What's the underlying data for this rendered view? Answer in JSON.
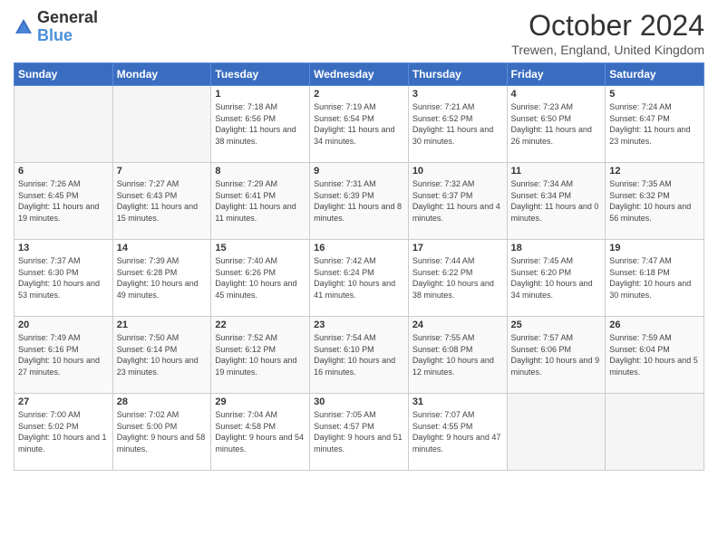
{
  "logo": {
    "general": "General",
    "blue": "Blue"
  },
  "title": "October 2024",
  "location": "Trewen, England, United Kingdom",
  "weekdays": [
    "Sunday",
    "Monday",
    "Tuesday",
    "Wednesday",
    "Thursday",
    "Friday",
    "Saturday"
  ],
  "weeks": [
    [
      {
        "day": "",
        "sunrise": "",
        "sunset": "",
        "daylight": ""
      },
      {
        "day": "",
        "sunrise": "",
        "sunset": "",
        "daylight": ""
      },
      {
        "day": "1",
        "sunrise": "Sunrise: 7:18 AM",
        "sunset": "Sunset: 6:56 PM",
        "daylight": "Daylight: 11 hours and 38 minutes."
      },
      {
        "day": "2",
        "sunrise": "Sunrise: 7:19 AM",
        "sunset": "Sunset: 6:54 PM",
        "daylight": "Daylight: 11 hours and 34 minutes."
      },
      {
        "day": "3",
        "sunrise": "Sunrise: 7:21 AM",
        "sunset": "Sunset: 6:52 PM",
        "daylight": "Daylight: 11 hours and 30 minutes."
      },
      {
        "day": "4",
        "sunrise": "Sunrise: 7:23 AM",
        "sunset": "Sunset: 6:50 PM",
        "daylight": "Daylight: 11 hours and 26 minutes."
      },
      {
        "day": "5",
        "sunrise": "Sunrise: 7:24 AM",
        "sunset": "Sunset: 6:47 PM",
        "daylight": "Daylight: 11 hours and 23 minutes."
      }
    ],
    [
      {
        "day": "6",
        "sunrise": "Sunrise: 7:26 AM",
        "sunset": "Sunset: 6:45 PM",
        "daylight": "Daylight: 11 hours and 19 minutes."
      },
      {
        "day": "7",
        "sunrise": "Sunrise: 7:27 AM",
        "sunset": "Sunset: 6:43 PM",
        "daylight": "Daylight: 11 hours and 15 minutes."
      },
      {
        "day": "8",
        "sunrise": "Sunrise: 7:29 AM",
        "sunset": "Sunset: 6:41 PM",
        "daylight": "Daylight: 11 hours and 11 minutes."
      },
      {
        "day": "9",
        "sunrise": "Sunrise: 7:31 AM",
        "sunset": "Sunset: 6:39 PM",
        "daylight": "Daylight: 11 hours and 8 minutes."
      },
      {
        "day": "10",
        "sunrise": "Sunrise: 7:32 AM",
        "sunset": "Sunset: 6:37 PM",
        "daylight": "Daylight: 11 hours and 4 minutes."
      },
      {
        "day": "11",
        "sunrise": "Sunrise: 7:34 AM",
        "sunset": "Sunset: 6:34 PM",
        "daylight": "Daylight: 11 hours and 0 minutes."
      },
      {
        "day": "12",
        "sunrise": "Sunrise: 7:35 AM",
        "sunset": "Sunset: 6:32 PM",
        "daylight": "Daylight: 10 hours and 56 minutes."
      }
    ],
    [
      {
        "day": "13",
        "sunrise": "Sunrise: 7:37 AM",
        "sunset": "Sunset: 6:30 PM",
        "daylight": "Daylight: 10 hours and 53 minutes."
      },
      {
        "day": "14",
        "sunrise": "Sunrise: 7:39 AM",
        "sunset": "Sunset: 6:28 PM",
        "daylight": "Daylight: 10 hours and 49 minutes."
      },
      {
        "day": "15",
        "sunrise": "Sunrise: 7:40 AM",
        "sunset": "Sunset: 6:26 PM",
        "daylight": "Daylight: 10 hours and 45 minutes."
      },
      {
        "day": "16",
        "sunrise": "Sunrise: 7:42 AM",
        "sunset": "Sunset: 6:24 PM",
        "daylight": "Daylight: 10 hours and 41 minutes."
      },
      {
        "day": "17",
        "sunrise": "Sunrise: 7:44 AM",
        "sunset": "Sunset: 6:22 PM",
        "daylight": "Daylight: 10 hours and 38 minutes."
      },
      {
        "day": "18",
        "sunrise": "Sunrise: 7:45 AM",
        "sunset": "Sunset: 6:20 PM",
        "daylight": "Daylight: 10 hours and 34 minutes."
      },
      {
        "day": "19",
        "sunrise": "Sunrise: 7:47 AM",
        "sunset": "Sunset: 6:18 PM",
        "daylight": "Daylight: 10 hours and 30 minutes."
      }
    ],
    [
      {
        "day": "20",
        "sunrise": "Sunrise: 7:49 AM",
        "sunset": "Sunset: 6:16 PM",
        "daylight": "Daylight: 10 hours and 27 minutes."
      },
      {
        "day": "21",
        "sunrise": "Sunrise: 7:50 AM",
        "sunset": "Sunset: 6:14 PM",
        "daylight": "Daylight: 10 hours and 23 minutes."
      },
      {
        "day": "22",
        "sunrise": "Sunrise: 7:52 AM",
        "sunset": "Sunset: 6:12 PM",
        "daylight": "Daylight: 10 hours and 19 minutes."
      },
      {
        "day": "23",
        "sunrise": "Sunrise: 7:54 AM",
        "sunset": "Sunset: 6:10 PM",
        "daylight": "Daylight: 10 hours and 16 minutes."
      },
      {
        "day": "24",
        "sunrise": "Sunrise: 7:55 AM",
        "sunset": "Sunset: 6:08 PM",
        "daylight": "Daylight: 10 hours and 12 minutes."
      },
      {
        "day": "25",
        "sunrise": "Sunrise: 7:57 AM",
        "sunset": "Sunset: 6:06 PM",
        "daylight": "Daylight: 10 hours and 9 minutes."
      },
      {
        "day": "26",
        "sunrise": "Sunrise: 7:59 AM",
        "sunset": "Sunset: 6:04 PM",
        "daylight": "Daylight: 10 hours and 5 minutes."
      }
    ],
    [
      {
        "day": "27",
        "sunrise": "Sunrise: 7:00 AM",
        "sunset": "Sunset: 5:02 PM",
        "daylight": "Daylight: 10 hours and 1 minute."
      },
      {
        "day": "28",
        "sunrise": "Sunrise: 7:02 AM",
        "sunset": "Sunset: 5:00 PM",
        "daylight": "Daylight: 9 hours and 58 minutes."
      },
      {
        "day": "29",
        "sunrise": "Sunrise: 7:04 AM",
        "sunset": "Sunset: 4:58 PM",
        "daylight": "Daylight: 9 hours and 54 minutes."
      },
      {
        "day": "30",
        "sunrise": "Sunrise: 7:05 AM",
        "sunset": "Sunset: 4:57 PM",
        "daylight": "Daylight: 9 hours and 51 minutes."
      },
      {
        "day": "31",
        "sunrise": "Sunrise: 7:07 AM",
        "sunset": "Sunset: 4:55 PM",
        "daylight": "Daylight: 9 hours and 47 minutes."
      },
      {
        "day": "",
        "sunrise": "",
        "sunset": "",
        "daylight": ""
      },
      {
        "day": "",
        "sunrise": "",
        "sunset": "",
        "daylight": ""
      }
    ]
  ]
}
